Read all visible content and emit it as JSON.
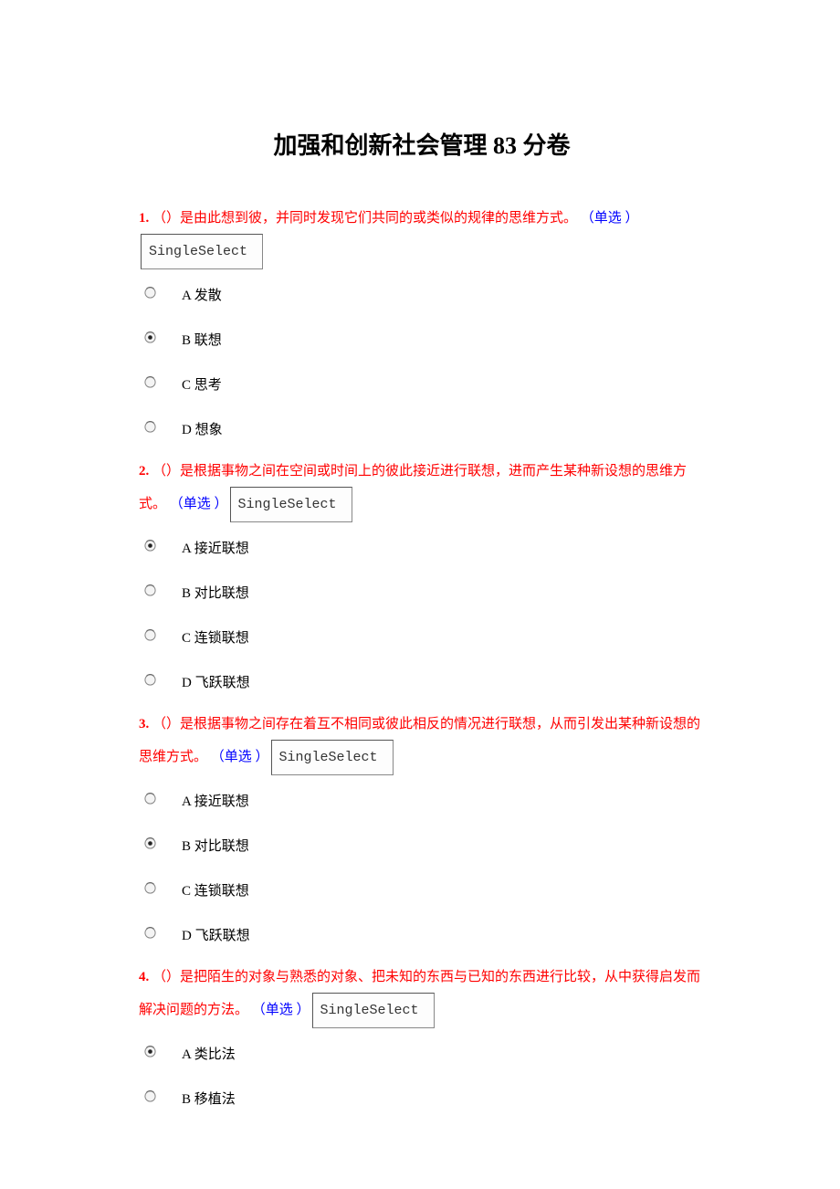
{
  "title": "加强和创新社会管理 83 分卷",
  "tag_label": "SingleSelect",
  "questions": [
    {
      "num": "1.",
      "text": "（）是由此想到彼，并同时发现它们共同的或类似的规律的思维方式。",
      "type": "（单选 ）",
      "selected": 1,
      "options": [
        "A 发散",
        "B 联想",
        "C 思考",
        "D 想象"
      ]
    },
    {
      "num": "2.",
      "text": "（）是根据事物之间在空间或时间上的彼此接近进行联想，进而产生某种新设想的思维方式。",
      "type": "（单选 ）",
      "selected": 0,
      "options": [
        "A 接近联想",
        "B 对比联想",
        "C 连锁联想",
        "D 飞跃联想"
      ]
    },
    {
      "num": "3.",
      "text": "（）是根据事物之间存在着互不相同或彼此相反的情况进行联想，从而引发出某种新设想的思维方式。",
      "type": "（单选 ）",
      "selected": 1,
      "options": [
        "A 接近联想",
        "B 对比联想",
        "C 连锁联想",
        "D 飞跃联想"
      ]
    },
    {
      "num": "4.",
      "text": "（）是把陌生的对象与熟悉的对象、把未知的东西与已知的东西进行比较，从中获得启发而解决问题的方法。",
      "type": "（单选 ）",
      "selected": 0,
      "options": [
        "A 类比法",
        "B 移植法"
      ]
    }
  ]
}
